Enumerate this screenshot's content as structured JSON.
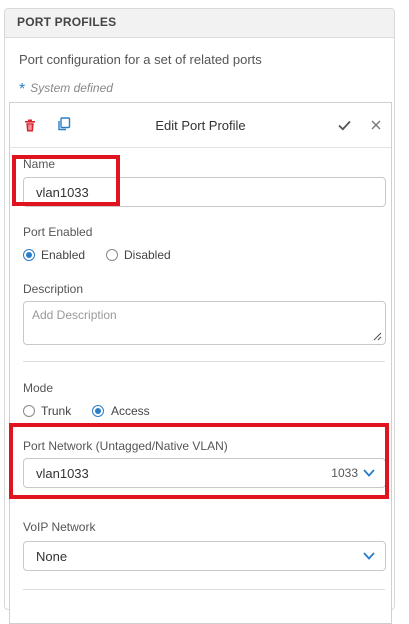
{
  "panel": {
    "title": "PORT PROFILES",
    "description": "Port configuration for a set of related ports",
    "system_defined": "System defined"
  },
  "editor": {
    "title": "Edit Port Profile",
    "name_label": "Name",
    "name_value": "vlan1033",
    "port_enabled_label": "Port Enabled",
    "port_enabled_options": [
      "Enabled",
      "Disabled"
    ],
    "port_enabled_selected": "Enabled",
    "description_label": "Description",
    "description_placeholder": "Add Description",
    "mode_label": "Mode",
    "mode_options": [
      "Trunk",
      "Access"
    ],
    "mode_selected": "Access",
    "port_network_label": "Port Network (Untagged/Native VLAN)",
    "port_network_value": "vlan1033",
    "port_network_vlan_id": "1033",
    "voip_label": "VoIP Network",
    "voip_value": "None"
  },
  "colors": {
    "accent": "#2a7ec9",
    "delete": "#d9232d",
    "highlight": "#e0141e"
  },
  "icons": [
    "trash-icon",
    "copy-icon",
    "check-icon",
    "close-icon",
    "chevron-down-icon",
    "star-icon",
    "resize-handle-icon"
  ]
}
